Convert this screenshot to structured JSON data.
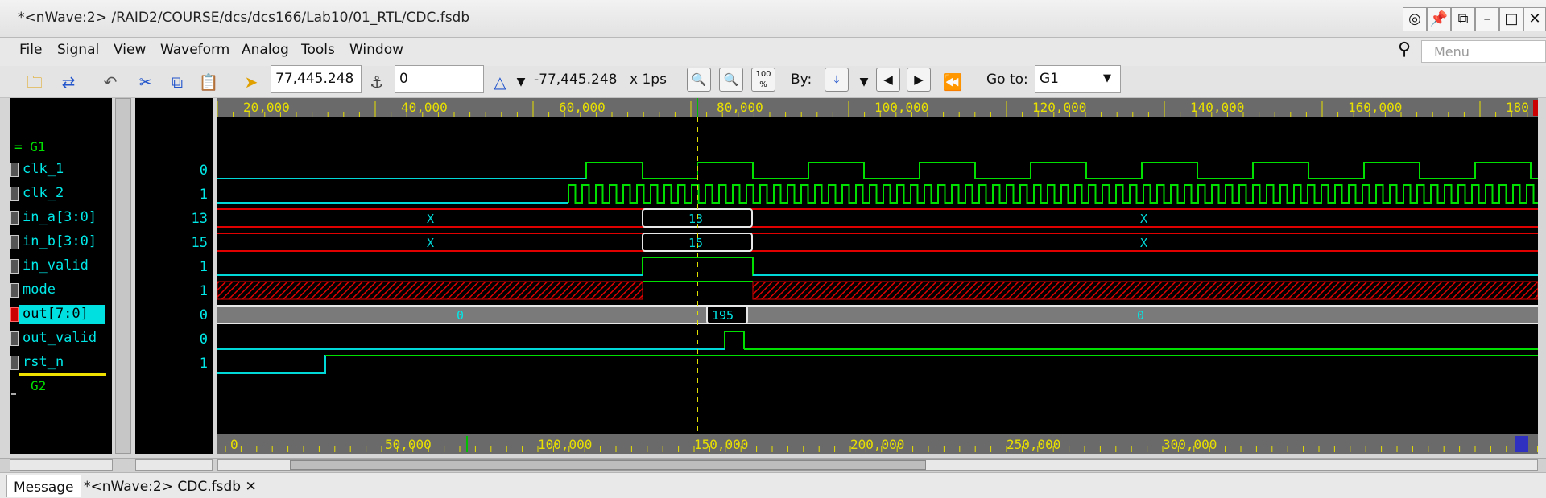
{
  "window": {
    "title": "*<nWave:2> /RAID2/COURSE/dcs/dcs166/Lab10/01_RTL/CDC.fsdb"
  },
  "menus": [
    "File",
    "Signal",
    "View",
    "Waveform",
    "Analog",
    "Tools",
    "Window"
  ],
  "menu_search_placeholder": "Menu",
  "toolbar": {
    "cursor_time": "77,445.248",
    "marker_time": "0",
    "delta": "-77,445.248",
    "unit": "x 1ps",
    "by_label": "By:",
    "goto_label": "Go to:",
    "goto_value": "G1",
    "zoom_fit_label": "100 %"
  },
  "groups": {
    "g1": "G1",
    "g2": "G2"
  },
  "signals": [
    {
      "name": "clk_1",
      "value": "0"
    },
    {
      "name": "clk_2",
      "value": "1"
    },
    {
      "name": "in_a[3:0]",
      "value": "13"
    },
    {
      "name": "in_b[3:0]",
      "value": "15"
    },
    {
      "name": "in_valid",
      "value": "1"
    },
    {
      "name": "mode",
      "value": "1"
    },
    {
      "name": "out[7:0]",
      "value": "0"
    },
    {
      "name": "out_valid",
      "value": "0"
    },
    {
      "name": "rst_n",
      "value": "1"
    }
  ],
  "waves": {
    "in_a_x1": "X",
    "in_a_val": "13",
    "in_a_x2": "X",
    "in_b_x1": "X",
    "in_b_val": "15",
    "in_b_x2": "X",
    "out_v1": "0",
    "out_val": "195",
    "out_v2": "0"
  },
  "top_ruler": [
    "20,000",
    "40,000",
    "60,000",
    "80,000",
    "100,000",
    "120,000",
    "140,000",
    "160,000",
    "180"
  ],
  "bottom_ruler": [
    "0",
    "50,000",
    "100,000",
    "150,000",
    "200,000",
    "250,000",
    "300,000"
  ],
  "tabs": [
    "Message",
    "*<nWave:2> CDC.fsdb"
  ]
}
